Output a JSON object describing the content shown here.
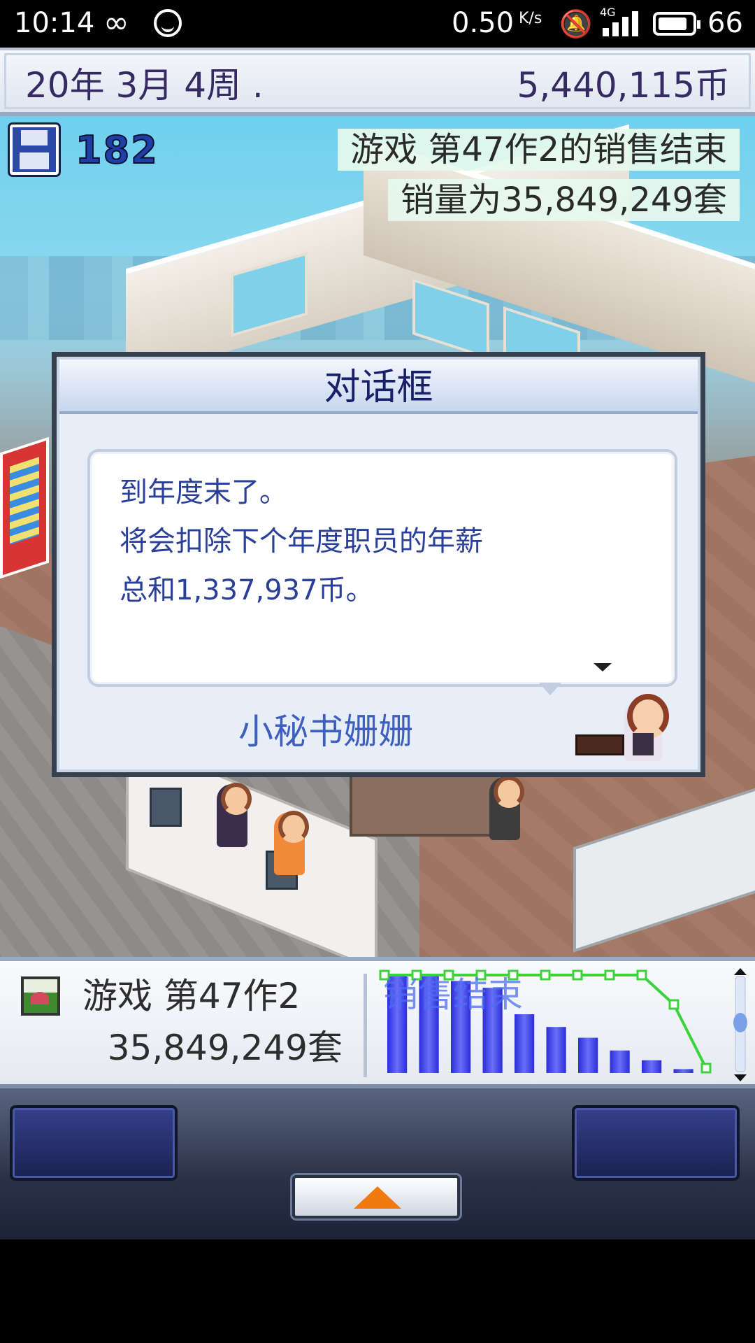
{
  "status_bar": {
    "time": "10:14",
    "infinity_icon": "∞",
    "net_speed": "0.50",
    "net_unit": "K/s",
    "network_type": "4G",
    "battery": "66"
  },
  "top_bar": {
    "date": "20年 3月 4周 .",
    "money": "5,440,115币"
  },
  "scene": {
    "save_count": "182",
    "notice_line1": "游戏 第47作2的销售结束",
    "notice_line2": "销量为35,849,249套"
  },
  "dialog": {
    "title": "对话框",
    "lines": [
      "到年度末了。",
      "将会扣除下个年度职员的年薪",
      "总和1,337,937币。"
    ],
    "speaker": "小秘书姗姗"
  },
  "bottom_info": {
    "game_name": "游戏 第47作2",
    "sales": "35,849,249套",
    "chart_label": "销售结束"
  },
  "chart_data": {
    "type": "bar",
    "label": "销售结束",
    "bars": [
      1.0,
      1.0,
      0.94,
      0.87,
      0.6,
      0.47,
      0.36,
      0.23,
      0.13,
      0.04
    ],
    "line": [
      1.0,
      1.0,
      1.0,
      1.0,
      1.0,
      1.0,
      1.0,
      1.0,
      1.0,
      0.7,
      0.05
    ],
    "colors": {
      "bars": "#3a3ef0",
      "line": "#3cd23c"
    }
  },
  "icons": {
    "save": "floppy-disk-icon",
    "up": "up-arrow-icon",
    "more": "more-down-arrow-icon"
  }
}
